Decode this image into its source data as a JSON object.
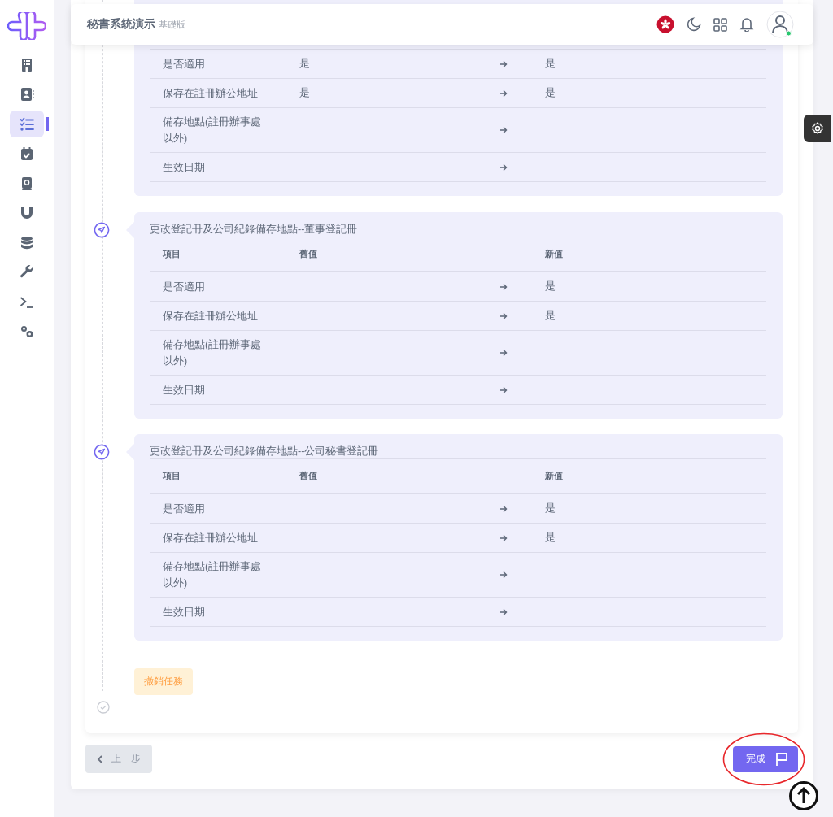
{
  "header": {
    "title": "秘書系統演示",
    "edition": "基礎版"
  },
  "sidebar": {
    "items": [
      {
        "kind": "building",
        "selected": false
      },
      {
        "kind": "contact",
        "selected": false
      },
      {
        "kind": "tasks",
        "selected": true
      },
      {
        "kind": "calendar",
        "selected": false
      },
      {
        "kind": "book",
        "selected": false
      },
      {
        "kind": "magnet",
        "selected": false
      },
      {
        "kind": "database",
        "selected": false
      },
      {
        "kind": "wrench",
        "selected": false
      },
      {
        "kind": "terminal",
        "selected": false
      },
      {
        "kind": "gears",
        "selected": false
      }
    ]
  },
  "sections": [
    {
      "rows": [
        {
          "item": "是否適用",
          "old": "是",
          "new": "是"
        },
        {
          "item": "保存在註冊辦公地址",
          "old": "是",
          "new": "是"
        },
        {
          "item": "備存地點(註冊辦事處以外)",
          "old": "",
          "new": ""
        },
        {
          "item": "生效日期",
          "old": "",
          "new": ""
        }
      ]
    },
    {
      "title": "更改登記冊及公司紀錄備存地點--董事登記冊",
      "columns": [
        "項目",
        "舊值",
        "新值"
      ],
      "rows": [
        {
          "item": "是否適用",
          "old": "",
          "new": "是"
        },
        {
          "item": "保存在註冊辦公地址",
          "old": "",
          "new": "是"
        },
        {
          "item": "備存地點(註冊辦事處以外)",
          "old": "",
          "new": ""
        },
        {
          "item": "生效日期",
          "old": "",
          "new": ""
        }
      ]
    },
    {
      "title": "更改登記冊及公司紀錄備存地點--公司秘書登記冊",
      "columns": [
        "項目",
        "舊值",
        "新值"
      ],
      "rows": [
        {
          "item": "是否適用",
          "old": "",
          "new": "是"
        },
        {
          "item": "保存在註冊辦公地址",
          "old": "",
          "new": "是"
        },
        {
          "item": "備存地點(註冊辦事處以外)",
          "old": "",
          "new": ""
        },
        {
          "item": "生效日期",
          "old": "",
          "new": ""
        }
      ]
    }
  ],
  "cancel_button": "撤銷任務",
  "prev_button": "上一步",
  "finish_button": "完成"
}
